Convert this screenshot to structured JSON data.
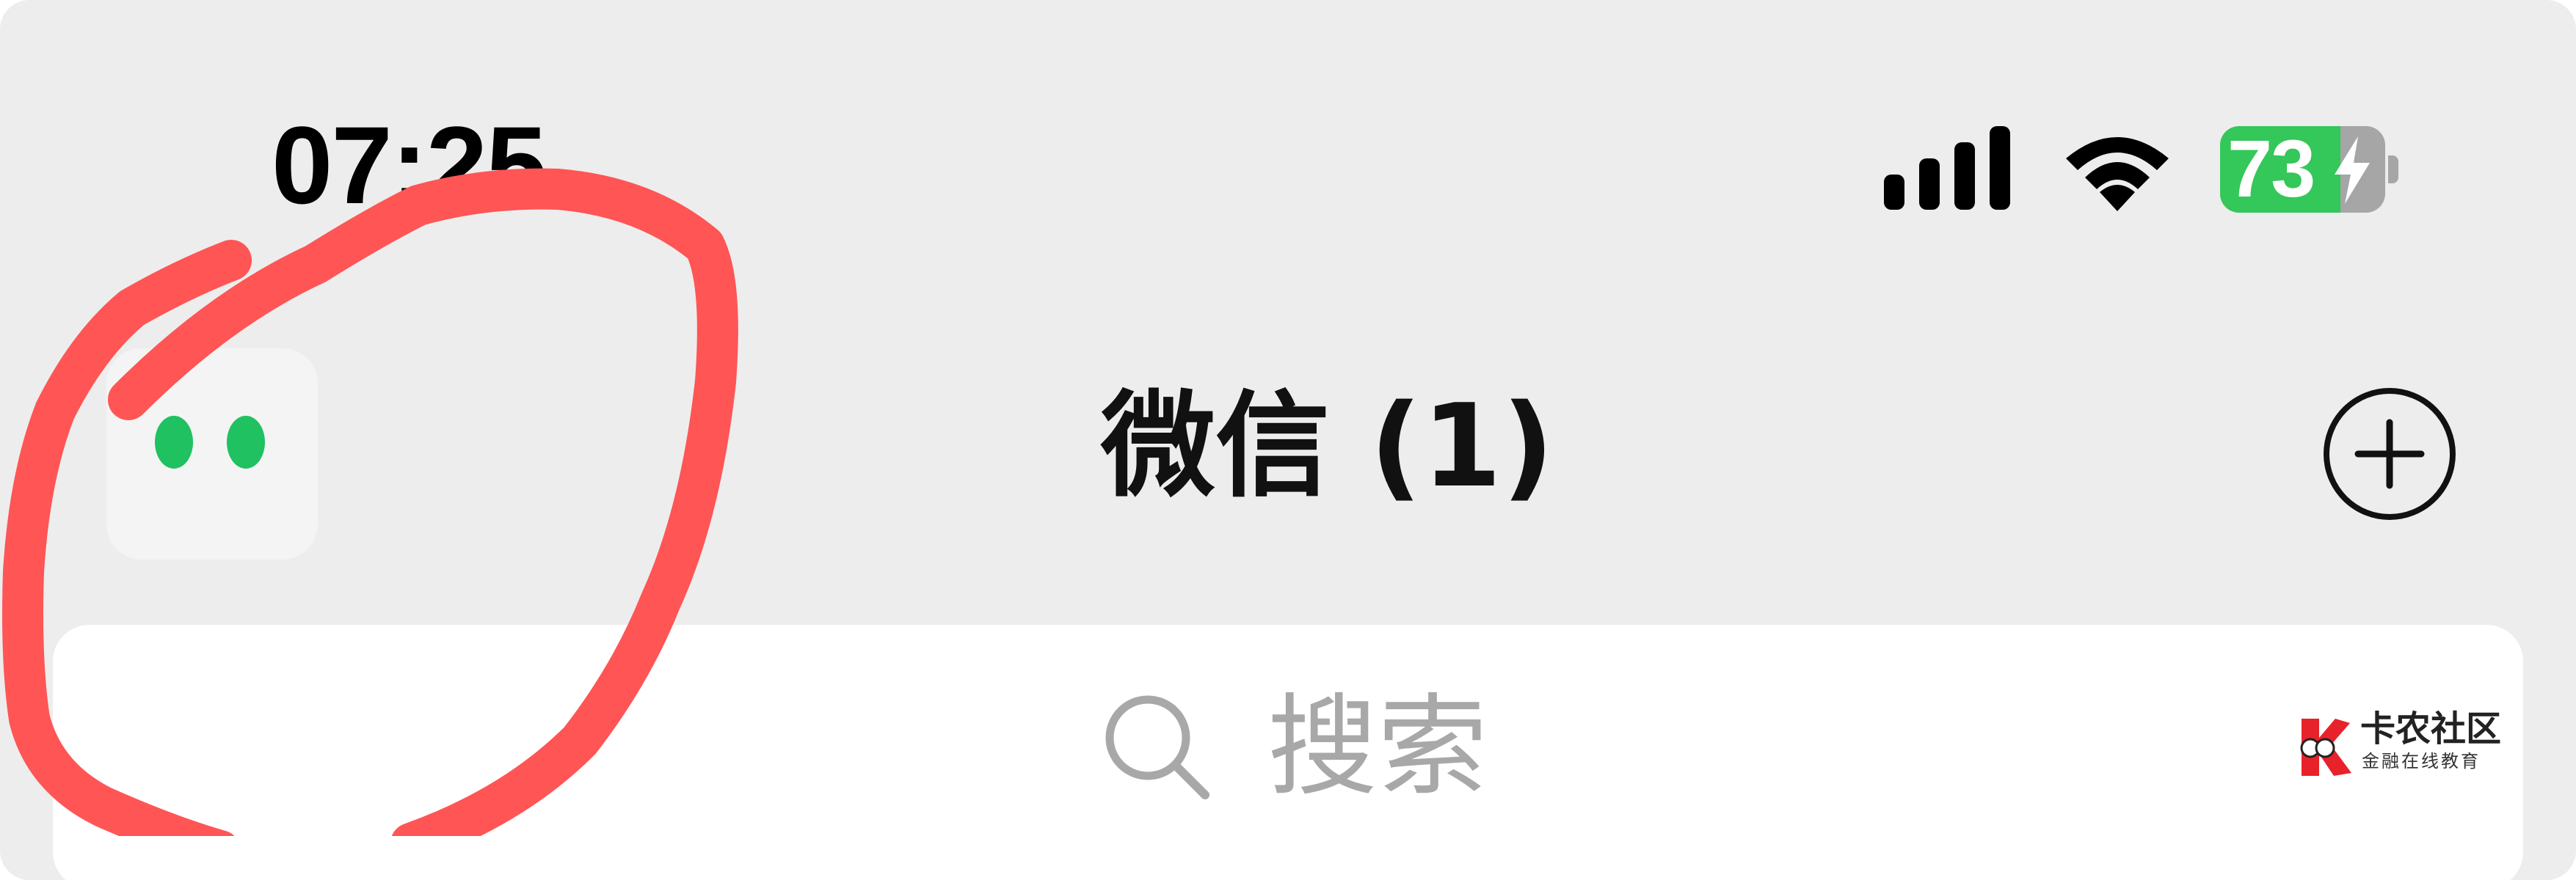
{
  "status_bar": {
    "time": "07:25",
    "battery_level": 73,
    "battery_text": "73",
    "battery_charging": true,
    "icons": [
      "cellular-signal-icon",
      "wifi-icon",
      "battery-icon",
      "charging-bolt-icon"
    ]
  },
  "nav": {
    "title": "微信 (1)",
    "left_icon": "mini-program-icon",
    "right_icon": "plus-circle-icon"
  },
  "search": {
    "placeholder": "搜索",
    "icon": "search-icon"
  },
  "watermark": {
    "name": "卡农社区",
    "tagline": "金融在线教育"
  },
  "annotation": {
    "type": "hand-drawn circle",
    "color": "#ff5555"
  },
  "colors": {
    "background": "#ededed",
    "accent_green": "#20c161",
    "battery_green": "#34c759",
    "scribble_red": "#ff5555",
    "brand_red": "#e8222a"
  }
}
